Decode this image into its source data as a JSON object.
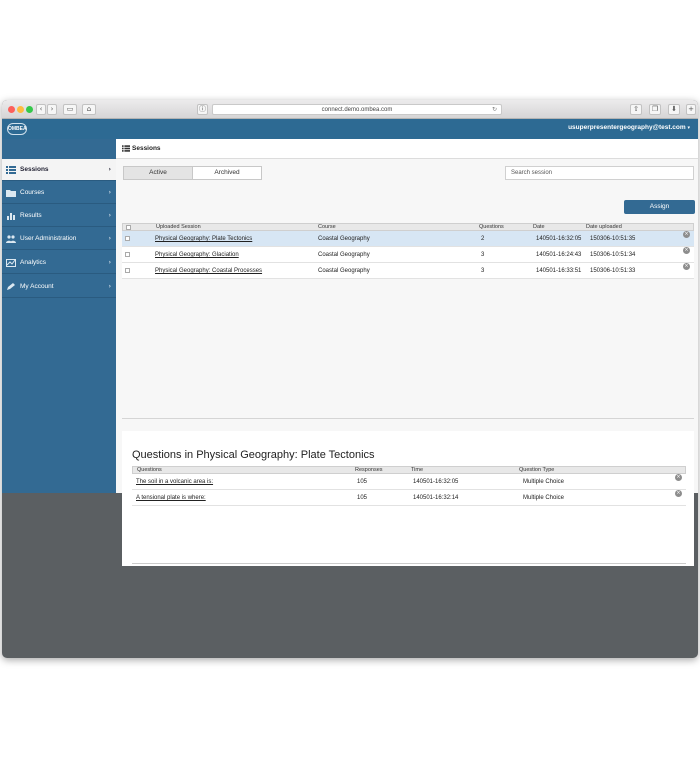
{
  "browser": {
    "url": "connect.demo.ombea.com"
  },
  "header": {
    "logo": "OMBEA",
    "user": "usuperpresentergeography@test.com"
  },
  "sidebar": {
    "items": [
      {
        "label": "Sessions"
      },
      {
        "label": "Courses"
      },
      {
        "label": "Results"
      },
      {
        "label": "User Administration"
      },
      {
        "label": "Analytics"
      },
      {
        "label": "My Account"
      }
    ]
  },
  "crumb": {
    "title": "Sessions"
  },
  "tabs": {
    "active": "Active",
    "archived": "Archived"
  },
  "search": {
    "placeholder": "Search session"
  },
  "assign_label": "Assign",
  "sessions": {
    "columns": [
      "Uploaded Session",
      "Course",
      "Questions",
      "Date",
      "Date uploaded"
    ],
    "rows": [
      {
        "session": "Physical Geography: Plate Tectonics",
        "course": "Coastal Geography",
        "questions": "2",
        "date": "140501-16:32:05",
        "uploaded": "150306-10:51:35"
      },
      {
        "session": "Physical Geography: Glaciation",
        "course": "Coastal Geography",
        "questions": "3",
        "date": "140501-16:24:43",
        "uploaded": "150306-10:51:34"
      },
      {
        "session": "Physical Geography: Coastal Processes",
        "course": "Coastal Geography",
        "questions": "3",
        "date": "140501-16:33:51",
        "uploaded": "150306-10:51:33"
      }
    ]
  },
  "questions_panel": {
    "title": "Questions in Physical Geography: Plate Tectonics",
    "columns": [
      "Questions",
      "Responses",
      "Time",
      "Question Type"
    ],
    "rows": [
      {
        "question": "The soil in a volcanic area is:",
        "responses": "105",
        "time": "140501-16:32:05",
        "type": "Multiple Choice"
      },
      {
        "question": "A tensional plate is where:",
        "responses": "105",
        "time": "140501-16:32:14",
        "type": "Multiple Choice"
      }
    ]
  },
  "colors": {
    "brand": "#2d6a93",
    "selected_row": "#d7e6f4",
    "background": "#5b5f62"
  }
}
